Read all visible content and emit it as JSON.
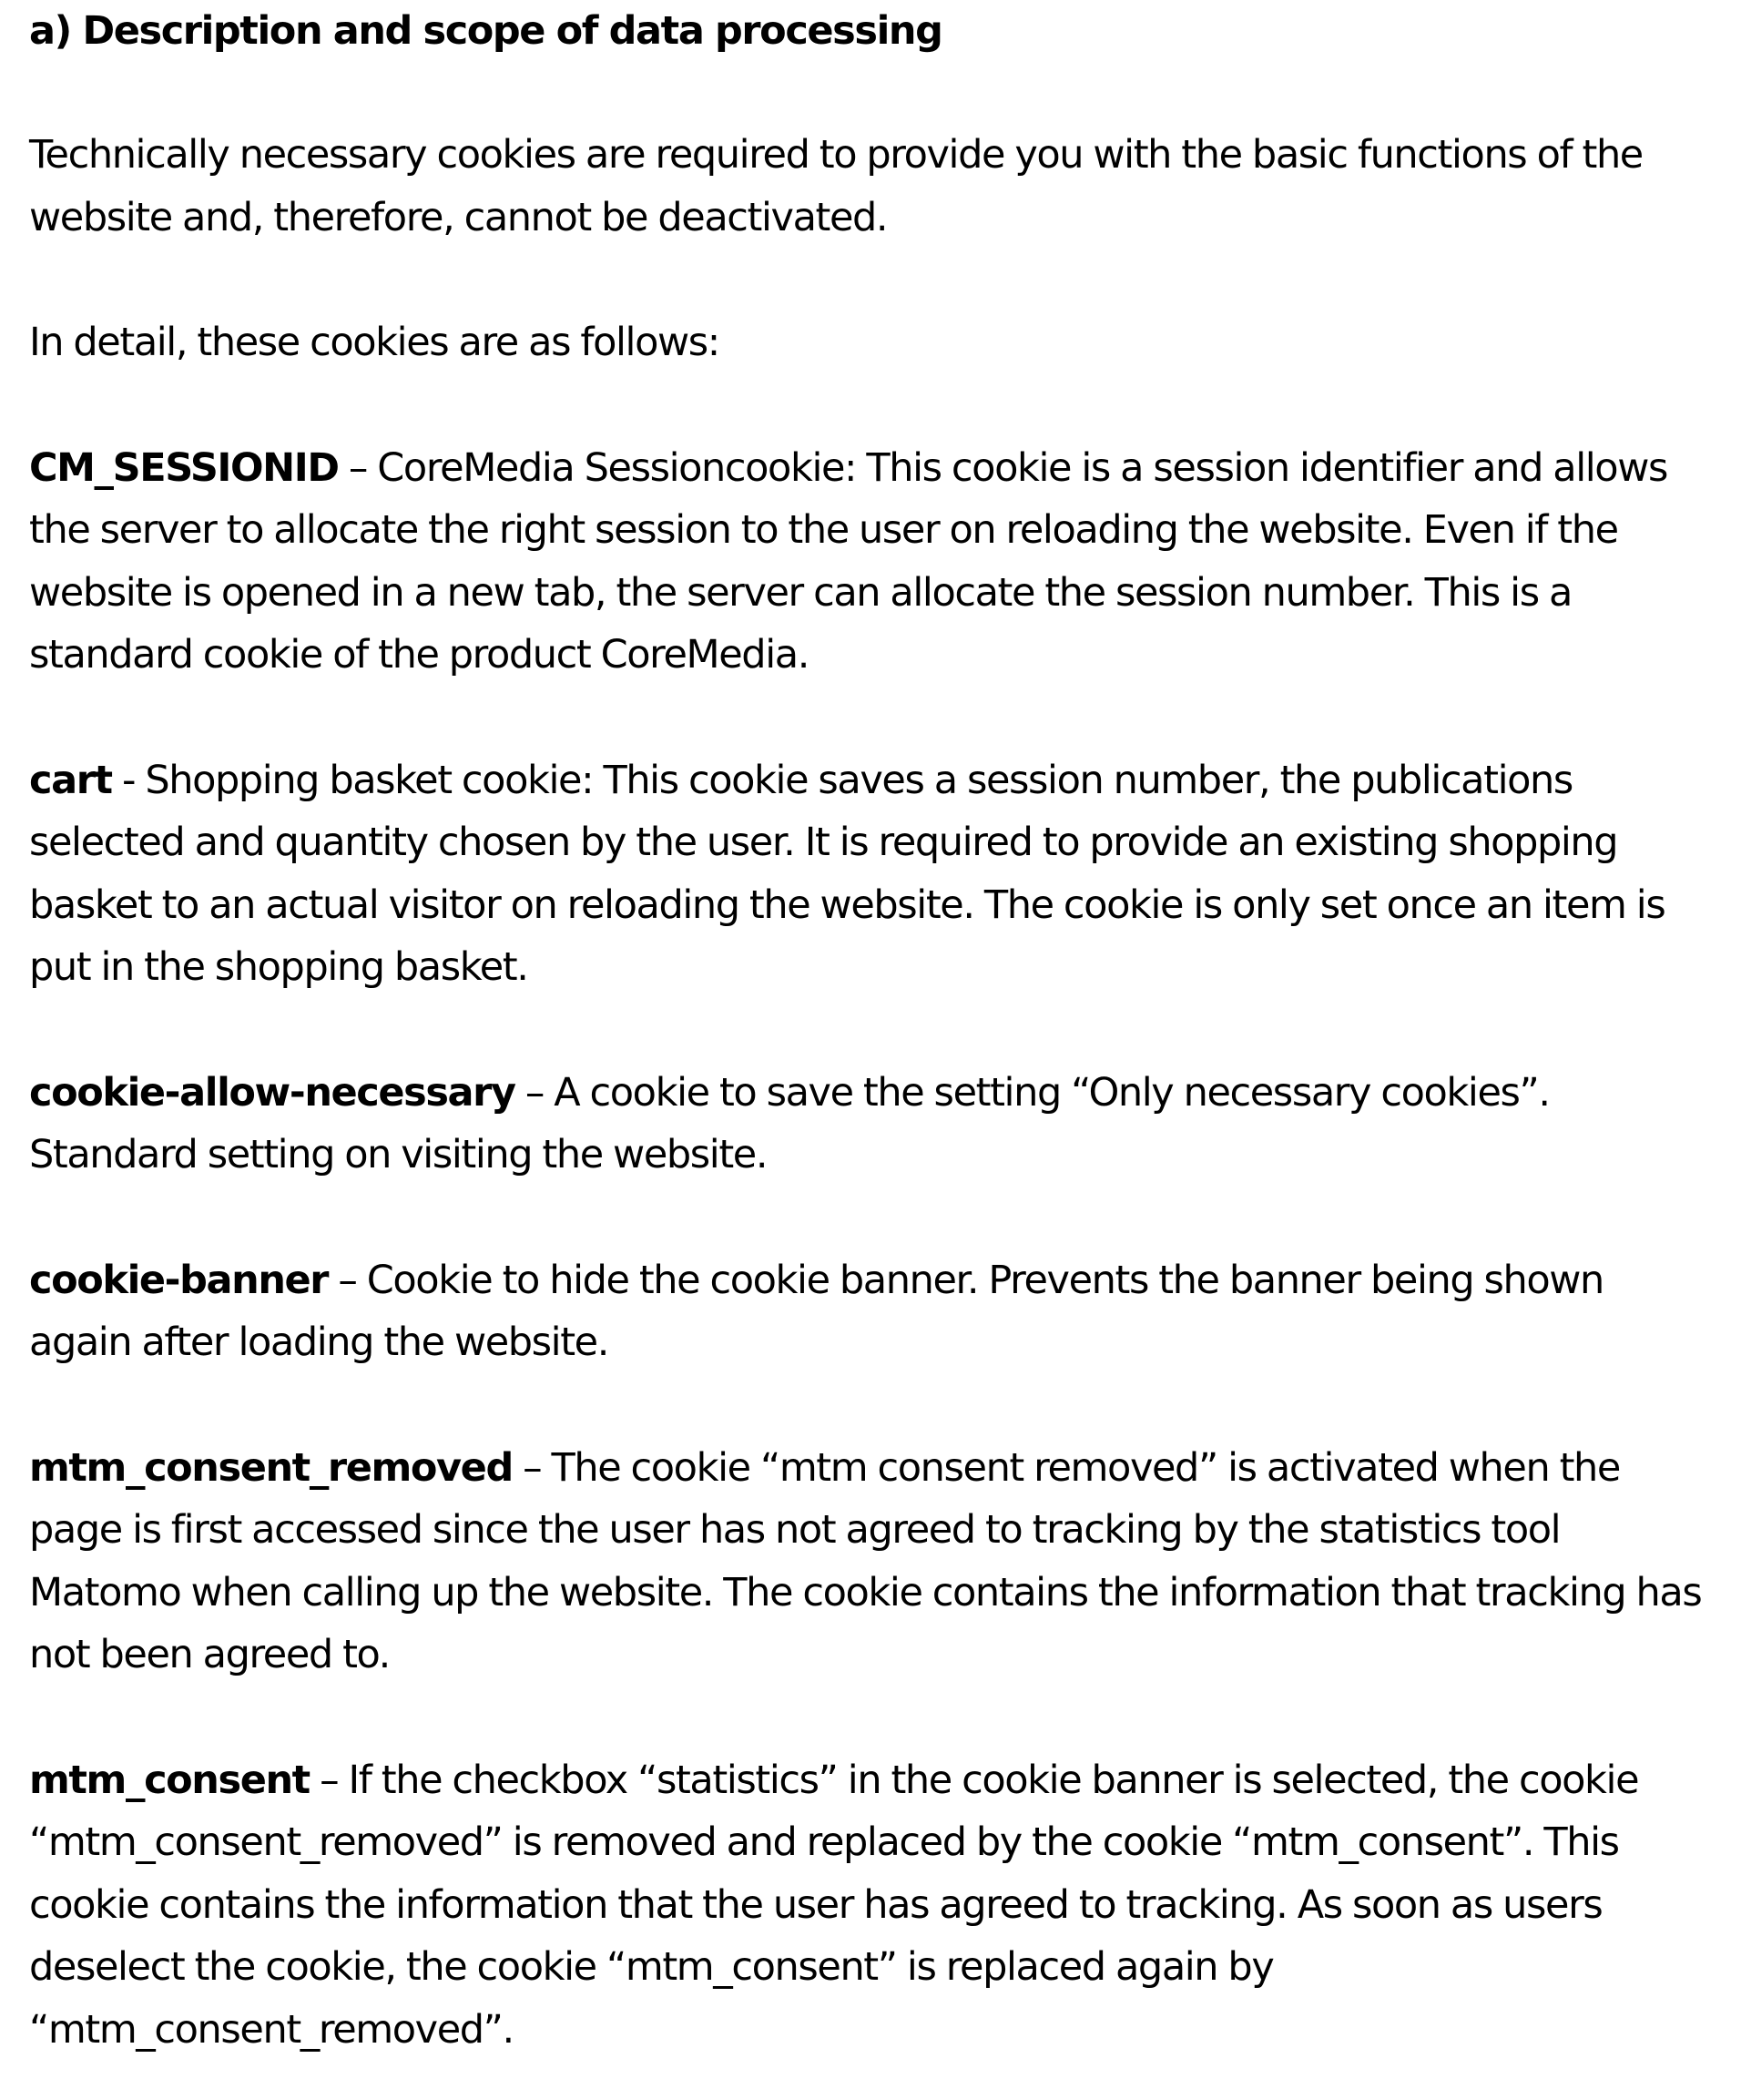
{
  "section": {
    "heading": "a) Description and scope of data processing",
    "intro": "Technically necessary cookies are required to provide you with the basic functions of the website and, therefore, cannot be deactivated.",
    "lead_in": "In detail, these cookies are as follows:"
  },
  "cookies": [
    {
      "name": "CM_SESSIONID",
      "separator": " – ",
      "description": "CoreMedia Sessioncookie: This cookie is a session identifier and allows the server to allocate the right session to the user on reloading the website. Even if the website is opened in a new tab, the server can allocate the session number. This is a standard cookie of the product CoreMedia."
    },
    {
      "name": "cart",
      "separator": " - ",
      "description": "Shopping basket cookie: This cookie saves a session number, the publications selected and quantity chosen by the user. It is required to provide an existing shopping basket to an actual visitor on reloading the website. The cookie is only set once an item is put in the shopping basket."
    },
    {
      "name": "cookie-allow-necessary",
      "separator": " – ",
      "description": "A cookie to save the setting “Only necessary cookies”. Standard setting on visiting the website."
    },
    {
      "name": "cookie-banner",
      "separator": " – ",
      "description": "Cookie to hide the cookie banner. Prevents the banner being shown again after loading the website."
    },
    {
      "name": "mtm_consent_removed",
      "separator": " – ",
      "description": "The cookie “mtm consent removed” is activated when the page is first accessed since the user has not agreed to tracking by the statistics tool Matomo when calling up the website. The cookie contains the information that tracking has not been agreed to."
    },
    {
      "name": "mtm_consent",
      "separator": " – ",
      "description": "If the checkbox “statistics” in the cookie banner is selected, the cookie “mtm_consent_removed” is removed and replaced by the cookie “mtm_consent”. This cookie contains the information that the user has agreed to tracking. As soon as users deselect the cookie, the cookie “mtm_consent” is replaced again by “mtm_consent_removed”."
    }
  ]
}
